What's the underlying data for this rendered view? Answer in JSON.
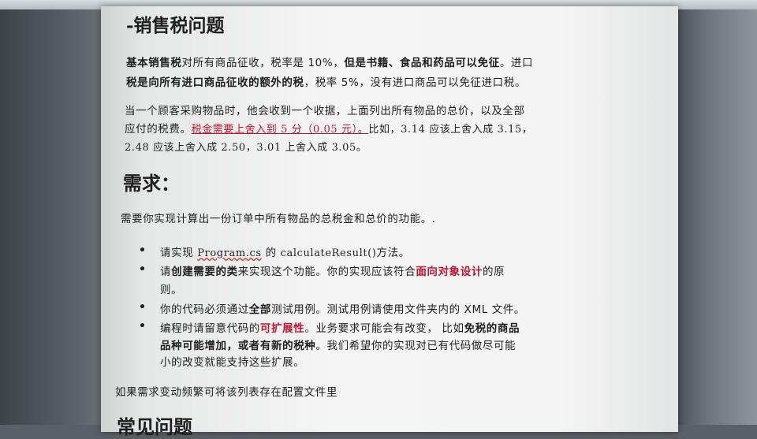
{
  "title": "-销售税问题",
  "intro": {
    "line1": {
      "bold1": "基本销售税",
      "text1": "对所有商品征收，税率是 10%，",
      "bold2": "但是书籍、食品和药品可以免征",
      "text2": "。进口"
    },
    "line2": {
      "bold1": "税是向所有进口商品征收的额外的税",
      "text1": "，税率 5%，没有进口商品可以免征进口税。"
    }
  },
  "para2": {
    "line1": "当一个顾客采购物品时，他会收到一个收据，上面列出所有物品的总价，以及全部",
    "line2_text": "应付的税费。",
    "line2_red": "税金需要上舍入到 5 分（0.05 元）。",
    "line2_tail": "比如，3.14 应该上舍入成 3.15，",
    "line3": "2.48 应该上舍入成 2.50，3.01 上舍入成 3.05。"
  },
  "req_heading": "需求：",
  "req_intro": "需要你实现计算出一份订单中所有物品的总税金和总价的功能。.",
  "bullet_symbol": "•",
  "bullets": {
    "b1": {
      "pre": "请实现 ",
      "code1": "Program.cs",
      "mid": " 的 ",
      "code2": "calculateResult()",
      "post": "方法。"
    },
    "b2": {
      "pre": "请",
      "bold": "创建需要的类",
      "mid": "来实现这个功能。你的实现应该符合",
      "red": "面向对象设计",
      "post": "的原",
      "line2": "则。"
    },
    "b3": {
      "pre": "你的代码必须通过",
      "bold": "全部",
      "post": "测试用例。测试用例请使用文件夹内的 XML 文件。"
    },
    "b4": {
      "pre": "编程时请留意代码的",
      "red": "可扩展性",
      "mid": "。业务要求可能会有改变，  比如",
      "bold1": "免税的商品",
      "line2_bold": "品种可能增加，或者有新的税种",
      "line2_text": "。我们希望你的实现对已有代码做尽可能",
      "line3": "小的改变就能支持这些扩展。"
    }
  },
  "config_note": "如果需求变动频繁可将该列表存在配置文件里",
  "next_heading_partial": "常见问题"
}
